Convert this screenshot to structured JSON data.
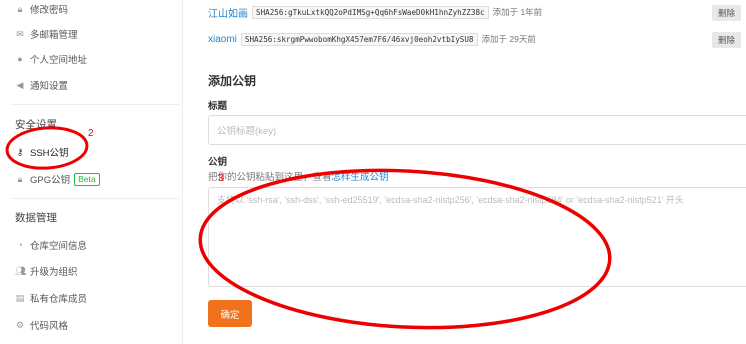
{
  "sidebar": {
    "items_top": [
      {
        "label": "修改密码",
        "icon": "lock-icon"
      },
      {
        "label": "多邮箱管理",
        "icon": "mail-icon"
      },
      {
        "label": "个人空间地址",
        "icon": "location-icon"
      },
      {
        "label": "通知设置",
        "icon": "speaker-icon"
      }
    ],
    "security_heading": "安全设置",
    "security_items": [
      {
        "label": "SSH公钥",
        "icon": "key-icon"
      },
      {
        "label": "GPG公钥",
        "icon": "lock-icon",
        "badge": "Beta"
      }
    ],
    "data_heading": "数据管理",
    "data_items": [
      {
        "label": "仓库空间信息",
        "icon": "pie-icon"
      },
      {
        "label": "升级为组织",
        "icon": "users-icon"
      },
      {
        "label": "私有仓库成员",
        "icon": "list-icon"
      },
      {
        "label": "代码风格",
        "icon": "gear-icon"
      }
    ]
  },
  "keys": [
    {
      "name": "江山如画",
      "fingerprint": "SHA256:gTkuLxtkQQ2oPdIMSg+Qq6hFsWaeD0kH1hnZyhZZ38c",
      "added": "添加于 1年前",
      "delete_label": "删除"
    },
    {
      "name": "xiaomi",
      "fingerprint": "SHA256:skrgmPwwobomKhgX457em7F6/46xvj0eoh2vtbIySU8",
      "added": "添加于 29天前",
      "delete_label": "删除"
    }
  ],
  "form": {
    "title": "添加公钥",
    "title_label": "标题",
    "title_placeholder": "公钥标题(key)",
    "key_label": "公钥",
    "hint_prefix": "把你的公钥粘贴到这里，查看",
    "hint_link": "怎样生成公钥",
    "key_placeholder": "支持以 'ssh-rsa', 'ssh-dss', 'ssh-ed25519', 'ecdsa-sha2-nistp256', 'ecdsa-sha2-nistp384' or 'ecdsa-sha2-nistp521' 开头",
    "submit_label": "确定"
  },
  "annotations": {
    "one": "2",
    "two": "3",
    "color": "#e00000"
  }
}
